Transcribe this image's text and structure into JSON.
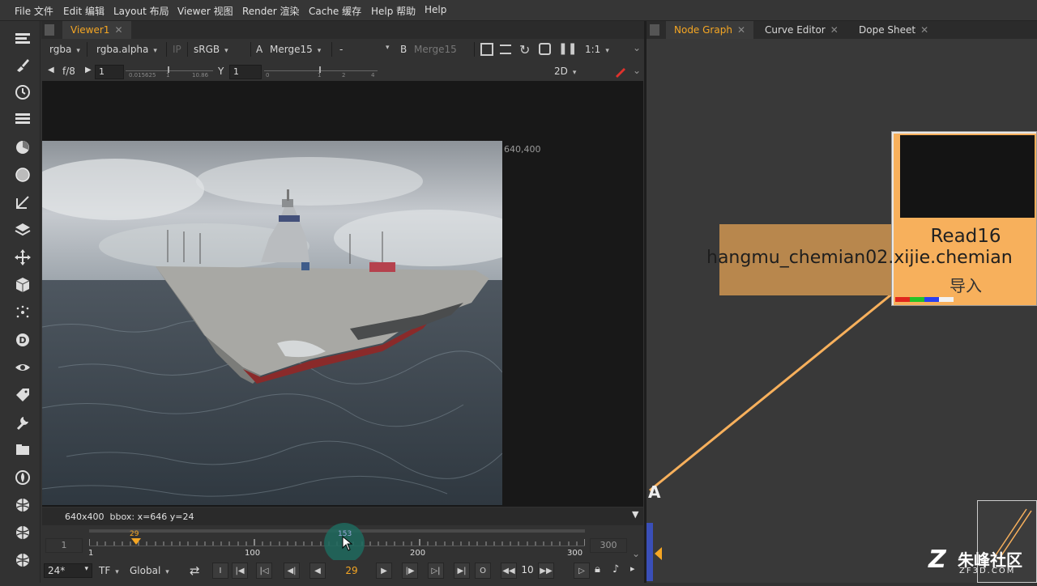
{
  "menubar": {
    "items": [
      "File 文件",
      "Edit 编辑",
      "Layout 布局",
      "Viewer 视图",
      "Render 渲染",
      "Cache 缓存",
      "Help 帮助",
      "Help"
    ]
  },
  "viewer": {
    "tab_label": "Viewer1",
    "channels": "rgba",
    "alpha_channel": "rgba.alpha",
    "ip_label": "IP",
    "colorspace": "sRGB",
    "input_a_label": "A",
    "input_a": "Merge15",
    "operation": "-",
    "input_b_label": "B",
    "input_b": "Merge15",
    "zoom": "1:1",
    "fstop": "f/8",
    "gain_value": "1",
    "gain_ticks": [
      "0.015625",
      "1",
      "10.86"
    ],
    "gamma_label": "Y",
    "gamma_value": "1",
    "gamma_ticks": [
      "0",
      "1",
      "2",
      "4"
    ],
    "view_mode": "2D",
    "image_corner_label": "640,400",
    "info_text": "640x400  bbox: x=646 y=24"
  },
  "timeline": {
    "start_frame": "1",
    "end_frame": "300",
    "tick_labels": [
      "1",
      "100",
      "200",
      "300"
    ],
    "in_marker": "29",
    "cursor_marker": "153",
    "current_frame": "29",
    "playhead_fraction": 0.515
  },
  "playbar": {
    "fps": "24*",
    "timecode_mode": "TF",
    "range_mode": "Global",
    "in_label": "I",
    "out_label": "O",
    "increment": "10"
  },
  "node_graph": {
    "tabs": [
      "Node Graph",
      "Curve Editor",
      "Dope Sheet"
    ],
    "read_node": {
      "name": "Read16",
      "file": "hangmu_chemian02.xijie.chemian",
      "label": "导入",
      "color": "#f7b05c"
    },
    "backdrop_color": "#b8874d",
    "input_label": "A"
  },
  "watermark": {
    "text": "朱峰社区",
    "subtext": "ZF3D.COM"
  },
  "colors": {
    "accent": "#f5a623",
    "panel_bg": "#323232",
    "viewport_bg": "#181818"
  }
}
